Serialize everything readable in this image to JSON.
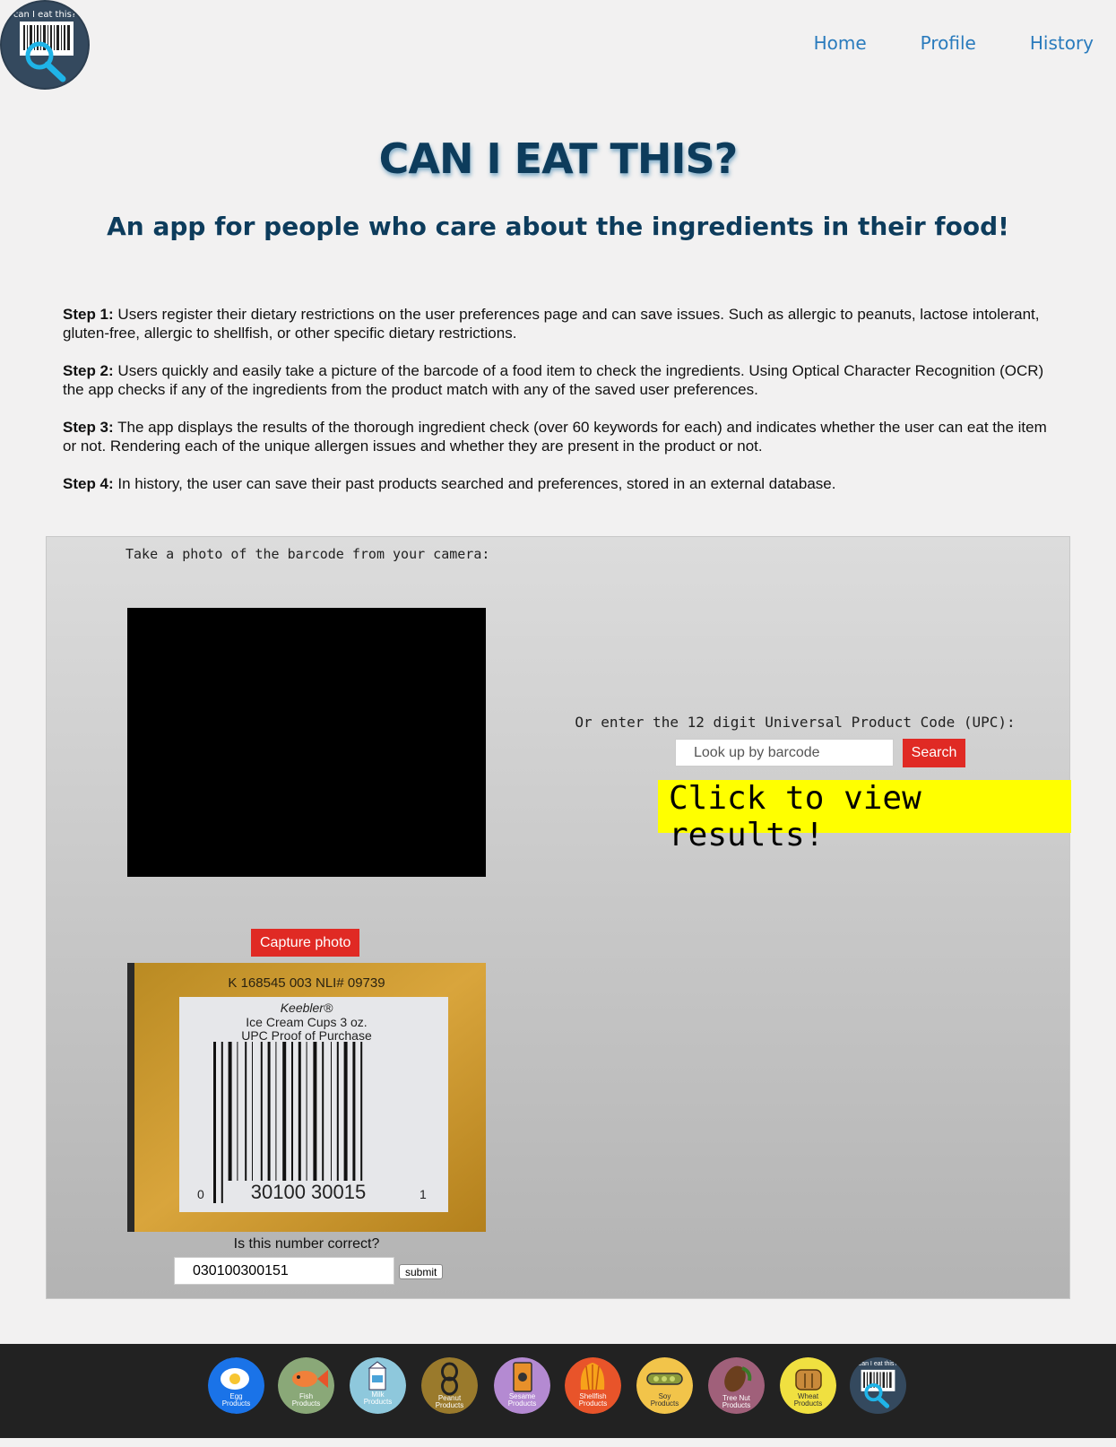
{
  "header": {
    "logo_text": "can I eat this?",
    "nav": [
      {
        "label": "Home"
      },
      {
        "label": "Profile"
      },
      {
        "label": "History"
      }
    ]
  },
  "hero": {
    "title": "CAN I EAT THIS?",
    "subtitle": "An app for people who care about the ingredients in their food!"
  },
  "steps": [
    {
      "label": "Step 1:",
      "text": " Users register their dietary restrictions on the user preferences page and can save issues. Such as allergic to peanuts, lactose intolerant, gluten-free, allergic to shellfish, or other specific dietary restrictions."
    },
    {
      "label": "Step 2:",
      "text": " Users quickly and easily take a picture of the barcode of a food item to check the ingredients. Using Optical Character Recognition (OCR) the app checks if any of the ingredients from the product match with any of the saved user preferences."
    },
    {
      "label": "Step 3:",
      "text": " The app displays the results of the thorough ingredient check (over 60 keywords for each) and indicates whether the user can eat the item or not. Rendering each of the unique allergen issues and whether they are present in the product or not."
    },
    {
      "label": "Step 4:",
      "text": " In history, the user can save their past products searched and preferences, stored in an external database."
    }
  ],
  "scanner": {
    "camera_label": "Take a photo of the barcode from your camera:",
    "capture_label": "Capture photo",
    "photo": {
      "line1": "K 168545 003 NLI# 09739",
      "line2": "Keebler®",
      "line3": "Ice Cream Cups 3 oz.",
      "line4": "UPC Proof of Purchase",
      "digit_left": "0",
      "digits": "30100 30015",
      "digit_right": "1"
    },
    "confirm_label": "Is this number correct?",
    "confirm_value": "030100300151",
    "submit_label": "submit",
    "upc_label": "Or enter the 12 digit Universal Product Code (UPC):",
    "search_placeholder": "Look up by barcode",
    "search_label": "Search",
    "results_label": "Click to view results!"
  },
  "footer": {
    "allergens": [
      {
        "label1": "Egg",
        "label2": "Products",
        "icon": "egg-icon",
        "color": "#1a73e8"
      },
      {
        "label1": "Fish",
        "label2": "Products",
        "icon": "fish-icon",
        "color": "#8aa878"
      },
      {
        "label1": "Milk",
        "label2": "Products",
        "icon": "milk-icon",
        "color": "#8ec8dc"
      },
      {
        "label1": "Peanut",
        "label2": "Products",
        "icon": "peanut-icon",
        "color": "#9a7a2c"
      },
      {
        "label1": "Sesame",
        "label2": "Products",
        "icon": "sesame-icon",
        "color": "#b48ad2"
      },
      {
        "label1": "Shellfish",
        "label2": "Products",
        "icon": "shellfish-icon",
        "color": "#e8542a"
      },
      {
        "label1": "Soy",
        "label2": "Products",
        "icon": "soy-icon",
        "color": "#f2c44a"
      },
      {
        "label1": "Tree Nut",
        "label2": "Products",
        "icon": "tree-nut-icon",
        "color": "#a0607a"
      },
      {
        "label1": "Wheat",
        "label2": "Products",
        "icon": "wheat-icon",
        "color": "#f0e040"
      }
    ],
    "logo_text": "can I eat this?"
  }
}
